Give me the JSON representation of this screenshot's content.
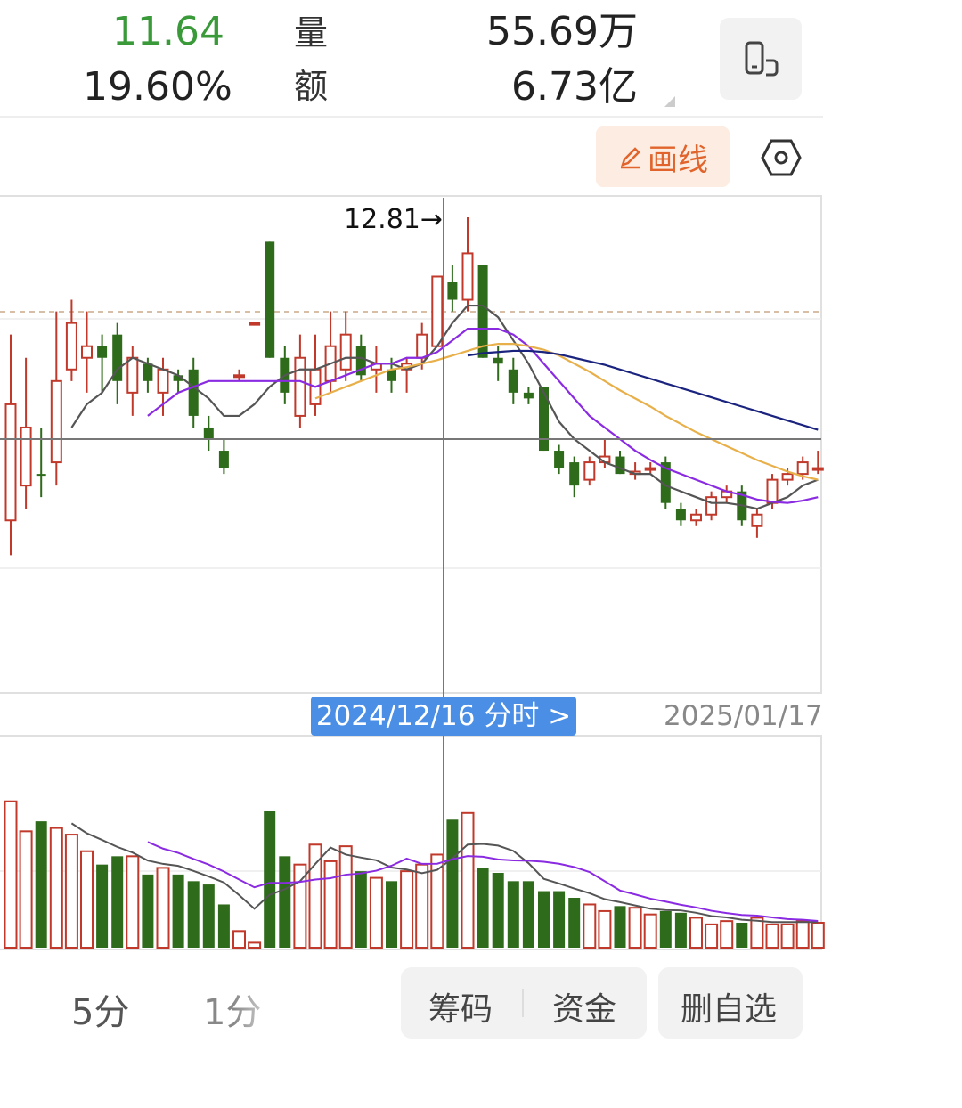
{
  "quote": {
    "price": "11.64",
    "change_pct": "19.60%",
    "volume_label": "量",
    "volume_value": "55.69万",
    "amount_label": "额",
    "amount_value": "6.73亿",
    "price_color": "#3a9a3a"
  },
  "toolbar": {
    "rotate_icon": "phone-rotate-icon",
    "draw_label": "画线",
    "draw_icon": "pencil-icon",
    "settings_icon": "hexagon-settings-icon"
  },
  "chart": {
    "crosshair_price": "12.81→",
    "crosshair_date": "2024/12/16 分时 >",
    "end_date": "2025/01/17"
  },
  "chart_data": {
    "type": "candlestick",
    "up_color": "#c0392b",
    "down_color": "#2e6b1a",
    "ma_colors": [
      "#555555",
      "#8a2be2",
      "#e8b04a",
      "#1a237e"
    ],
    "candles": [
      {
        "open": 10.2,
        "close": 11.2,
        "high": 11.8,
        "low": 9.9,
        "up": true
      },
      {
        "open": 10.5,
        "close": 11.0,
        "high": 11.6,
        "low": 10.3,
        "up": true
      },
      {
        "open": 10.6,
        "close": 10.6,
        "high": 11.0,
        "low": 10.4,
        "up": false
      },
      {
        "open": 10.7,
        "close": 11.4,
        "high": 12.0,
        "low": 10.5,
        "up": true
      },
      {
        "open": 11.5,
        "close": 11.9,
        "high": 12.1,
        "low": 11.4,
        "up": true
      },
      {
        "open": 11.6,
        "close": 11.7,
        "high": 12.0,
        "low": 11.3,
        "up": true
      },
      {
        "open": 11.7,
        "close": 11.6,
        "high": 11.8,
        "low": 11.3,
        "up": false
      },
      {
        "open": 11.8,
        "close": 11.4,
        "high": 11.9,
        "low": 11.2,
        "up": false
      },
      {
        "open": 11.3,
        "close": 11.6,
        "high": 11.7,
        "low": 11.1,
        "up": true
      },
      {
        "open": 11.55,
        "close": 11.4,
        "high": 11.6,
        "low": 11.3,
        "up": false
      },
      {
        "open": 11.3,
        "close": 11.5,
        "high": 11.6,
        "low": 11.1,
        "up": true
      },
      {
        "open": 11.45,
        "close": 11.4,
        "high": 11.5,
        "low": 11.3,
        "up": false
      },
      {
        "open": 11.5,
        "close": 11.1,
        "high": 11.6,
        "low": 11.0,
        "up": false
      },
      {
        "open": 11.0,
        "close": 10.9,
        "high": 11.1,
        "low": 10.8,
        "up": false
      },
      {
        "open": 10.8,
        "close": 10.65,
        "high": 10.9,
        "low": 10.6,
        "up": false
      },
      {
        "open": 11.45,
        "close": 11.45,
        "high": 11.5,
        "low": 11.4,
        "up": true
      },
      {
        "open": 11.9,
        "close": 11.9,
        "high": 11.9,
        "low": 11.9,
        "up": true
      },
      {
        "open": 12.6,
        "close": 11.6,
        "high": 12.6,
        "low": 11.6,
        "up": false
      },
      {
        "open": 11.6,
        "close": 11.3,
        "high": 11.7,
        "low": 11.2,
        "up": false
      },
      {
        "open": 11.1,
        "close": 11.6,
        "high": 11.8,
        "low": 11.0,
        "up": true
      },
      {
        "open": 11.2,
        "close": 11.5,
        "high": 11.8,
        "low": 11.1,
        "up": true
      },
      {
        "open": 11.4,
        "close": 11.7,
        "high": 12.0,
        "low": 11.3,
        "up": true
      },
      {
        "open": 11.5,
        "close": 11.8,
        "high": 12.0,
        "low": 11.4,
        "up": true
      },
      {
        "open": 11.7,
        "close": 11.45,
        "high": 11.8,
        "low": 11.4,
        "up": false
      },
      {
        "open": 11.5,
        "close": 11.55,
        "high": 11.7,
        "low": 11.3,
        "up": true
      },
      {
        "open": 11.5,
        "close": 11.4,
        "high": 11.6,
        "low": 11.3,
        "up": false
      },
      {
        "open": 11.5,
        "close": 11.55,
        "high": 11.6,
        "low": 11.3,
        "up": true
      },
      {
        "open": 11.6,
        "close": 11.8,
        "high": 11.9,
        "low": 11.5,
        "up": true
      },
      {
        "open": 11.7,
        "close": 12.3,
        "high": 12.3,
        "low": 11.7,
        "up": true
      },
      {
        "open": 12.25,
        "close": 12.1,
        "high": 12.4,
        "low": 12.0,
        "up": false
      },
      {
        "open": 12.1,
        "close": 12.5,
        "high": 12.81,
        "low": 12.0,
        "up": true
      },
      {
        "open": 12.4,
        "close": 11.6,
        "high": 12.4,
        "low": 11.6,
        "up": false
      },
      {
        "open": 11.6,
        "close": 11.55,
        "high": 11.7,
        "low": 11.4,
        "up": false
      },
      {
        "open": 11.5,
        "close": 11.3,
        "high": 11.6,
        "low": 11.2,
        "up": false
      },
      {
        "open": 11.3,
        "close": 11.25,
        "high": 11.35,
        "low": 11.2,
        "up": false
      },
      {
        "open": 11.35,
        "close": 10.8,
        "high": 11.35,
        "low": 10.8,
        "up": false
      },
      {
        "open": 10.8,
        "close": 10.65,
        "high": 10.85,
        "low": 10.6,
        "up": false
      },
      {
        "open": 10.7,
        "close": 10.5,
        "high": 10.75,
        "low": 10.4,
        "up": false
      },
      {
        "open": 10.55,
        "close": 10.7,
        "high": 10.75,
        "low": 10.5,
        "up": true
      },
      {
        "open": 10.7,
        "close": 10.75,
        "high": 10.9,
        "low": 10.65,
        "up": true
      },
      {
        "open": 10.75,
        "close": 10.6,
        "high": 10.8,
        "low": 10.6,
        "up": false
      },
      {
        "open": 10.6,
        "close": 10.62,
        "high": 10.7,
        "low": 10.55,
        "up": true
      },
      {
        "open": 10.65,
        "close": 10.65,
        "high": 10.7,
        "low": 10.6,
        "up": true
      },
      {
        "open": 10.7,
        "close": 10.35,
        "high": 10.75,
        "low": 10.3,
        "up": false
      },
      {
        "open": 10.3,
        "close": 10.2,
        "high": 10.35,
        "low": 10.15,
        "up": false
      },
      {
        "open": 10.2,
        "close": 10.25,
        "high": 10.3,
        "low": 10.15,
        "up": true
      },
      {
        "open": 10.25,
        "close": 10.4,
        "high": 10.45,
        "low": 10.2,
        "up": true
      },
      {
        "open": 10.4,
        "close": 10.45,
        "high": 10.5,
        "low": 10.35,
        "up": true
      },
      {
        "open": 10.45,
        "close": 10.2,
        "high": 10.5,
        "low": 10.15,
        "up": false
      },
      {
        "open": 10.15,
        "close": 10.25,
        "high": 10.3,
        "low": 10.05,
        "up": true
      },
      {
        "open": 10.35,
        "close": 10.55,
        "high": 10.6,
        "low": 10.3,
        "up": true
      },
      {
        "open": 10.55,
        "close": 10.6,
        "high": 10.65,
        "low": 10.5,
        "up": true
      },
      {
        "open": 10.6,
        "close": 10.7,
        "high": 10.75,
        "low": 10.55,
        "up": true
      },
      {
        "open": 10.65,
        "close": 10.65,
        "high": 10.8,
        "low": 10.6,
        "up": true
      }
    ],
    "volume": [
      88,
      70,
      76,
      72,
      68,
      58,
      50,
      55,
      55,
      44,
      48,
      44,
      40,
      38,
      26,
      10,
      3,
      82,
      55,
      50,
      62,
      52,
      61,
      46,
      42,
      40,
      46,
      50,
      56,
      77,
      81,
      48,
      45,
      40,
      40,
      34,
      34,
      30,
      26,
      22,
      25,
      24,
      20,
      22,
      21,
      18,
      14,
      16,
      15,
      18,
      14,
      14,
      16,
      15
    ],
    "ma_price": [
      [
        null,
        null,
        null,
        null,
        11.0,
        11.2,
        11.3,
        11.5,
        11.6,
        11.55,
        11.5,
        11.45,
        11.35,
        11.25,
        11.1,
        11.1,
        11.2,
        11.35,
        11.45,
        11.5,
        11.5,
        11.55,
        11.6,
        11.6,
        11.55,
        11.55,
        11.5,
        11.55,
        11.7,
        11.9,
        12.05,
        12.05,
        11.95,
        11.75,
        11.55,
        11.3,
        11.05,
        10.9,
        10.8,
        10.7,
        10.65,
        10.6,
        10.6,
        10.5,
        10.45,
        10.4,
        10.35,
        10.35,
        10.33,
        10.3,
        10.35,
        10.4,
        10.5,
        10.55
      ],
      [
        null,
        null,
        null,
        null,
        null,
        null,
        null,
        null,
        null,
        11.1,
        11.2,
        11.3,
        11.35,
        11.4,
        11.4,
        11.4,
        11.4,
        11.4,
        11.4,
        11.4,
        11.35,
        11.4,
        11.45,
        11.5,
        11.55,
        11.55,
        11.6,
        11.6,
        11.65,
        11.75,
        11.85,
        11.85,
        11.85,
        11.8,
        11.7,
        11.55,
        11.4,
        11.25,
        11.1,
        11.0,
        10.9,
        10.8,
        10.72,
        10.65,
        10.6,
        10.55,
        10.5,
        10.45,
        10.42,
        10.38,
        10.36,
        10.35,
        10.37,
        10.4
      ],
      [
        null,
        null,
        null,
        null,
        null,
        null,
        null,
        null,
        null,
        null,
        null,
        null,
        null,
        null,
        null,
        null,
        null,
        null,
        null,
        null,
        11.25,
        11.3,
        11.35,
        11.4,
        11.45,
        11.5,
        11.52,
        11.55,
        11.58,
        11.62,
        11.66,
        11.7,
        11.72,
        11.72,
        11.7,
        11.67,
        11.62,
        11.55,
        11.48,
        11.4,
        11.32,
        11.25,
        11.18,
        11.1,
        11.03,
        10.96,
        10.9,
        10.84,
        10.78,
        10.72,
        10.67,
        10.62,
        10.58,
        10.55
      ],
      [
        null,
        null,
        null,
        null,
        null,
        null,
        null,
        null,
        null,
        null,
        null,
        null,
        null,
        null,
        null,
        null,
        null,
        null,
        null,
        null,
        null,
        null,
        null,
        null,
        null,
        null,
        null,
        null,
        null,
        null,
        11.62,
        11.64,
        11.65,
        11.66,
        11.66,
        11.65,
        11.63,
        11.6,
        11.57,
        11.54,
        11.5,
        11.46,
        11.42,
        11.38,
        11.34,
        11.3,
        11.26,
        11.22,
        11.18,
        11.14,
        11.1,
        11.06,
        11.02,
        10.98
      ]
    ]
  },
  "bottom": {
    "tab_5min": "5分",
    "tab_1min": "1分",
    "chips_label": "筹码",
    "funds_label": "资金",
    "remove_label": "删自选"
  }
}
